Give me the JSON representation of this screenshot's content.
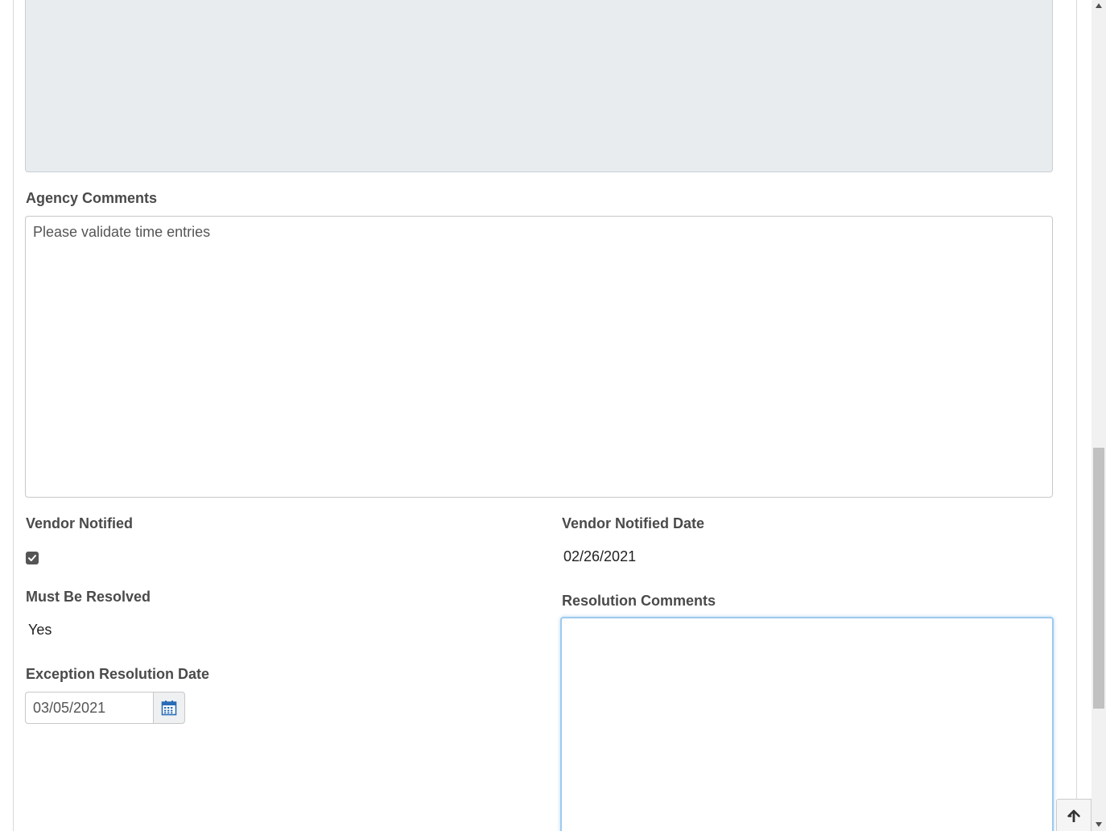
{
  "agency_comments": {
    "label": "Agency Comments",
    "value": "Please validate time entries"
  },
  "vendor_notified": {
    "label": "Vendor Notified",
    "checked": true
  },
  "vendor_notified_date": {
    "label": "Vendor Notified Date",
    "value": "02/26/2021"
  },
  "must_be_resolved": {
    "label": "Must Be Resolved",
    "value": "Yes"
  },
  "resolution_comments": {
    "label": "Resolution Comments",
    "value": ""
  },
  "exception_resolution_date": {
    "label": "Exception Resolution Date",
    "value": "03/05/2021"
  },
  "icons": {
    "calendar": "calendar-icon",
    "checkmark": "checkmark-icon",
    "back_to_top": "arrow-up-icon"
  },
  "colors": {
    "readonly_bg": "#e8ecef",
    "focus_border": "#9ecaed",
    "calendar_icon": "#2a6db5"
  }
}
